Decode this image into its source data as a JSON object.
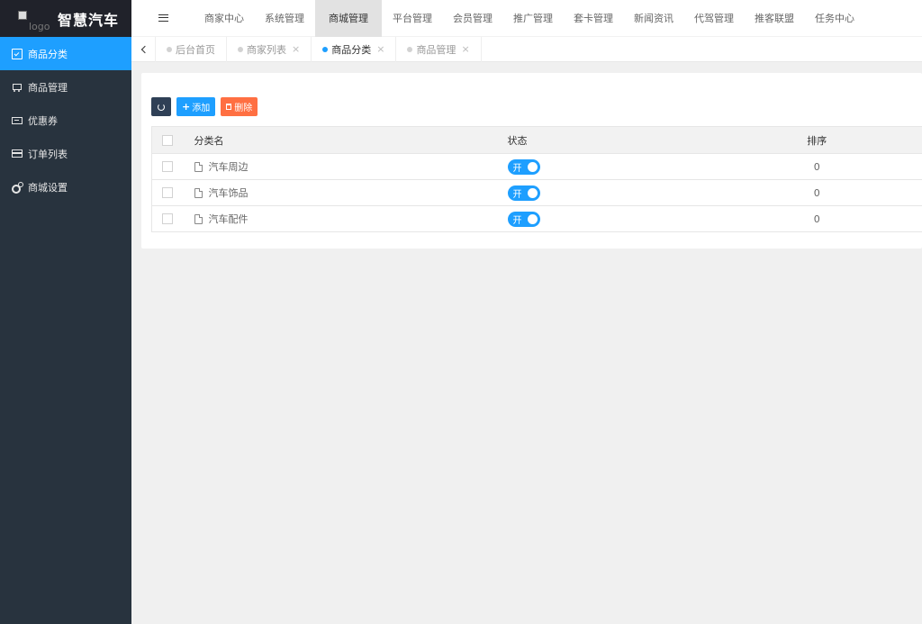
{
  "app": {
    "title": "智慧汽车",
    "logo_alt": "logo"
  },
  "sidebar": {
    "items": [
      {
        "label": "商品分类",
        "icon": "calendar-check-icon",
        "active": true
      },
      {
        "label": "商品管理",
        "icon": "cart-icon"
      },
      {
        "label": "优惠券",
        "icon": "money-icon"
      },
      {
        "label": "订单列表",
        "icon": "card-icon"
      },
      {
        "label": "商城设置",
        "icon": "gears-icon"
      }
    ]
  },
  "topnav": {
    "items": [
      {
        "label": "商家中心"
      },
      {
        "label": "系统管理"
      },
      {
        "label": "商城管理",
        "active": true
      },
      {
        "label": "平台管理"
      },
      {
        "label": "会员管理"
      },
      {
        "label": "推广管理"
      },
      {
        "label": "套卡管理"
      },
      {
        "label": "新闻资讯"
      },
      {
        "label": "代驾管理"
      },
      {
        "label": "推客联盟"
      },
      {
        "label": "任务中心"
      }
    ]
  },
  "tabs": [
    {
      "label": "后台首页",
      "closable": false
    },
    {
      "label": "商家列表",
      "closable": true,
      "close": "×"
    },
    {
      "label": "商品分类",
      "closable": true,
      "close": "×",
      "active": true
    },
    {
      "label": "商品管理",
      "closable": true,
      "close": "×"
    }
  ],
  "toolbar": {
    "add_label": "添加",
    "delete_label": "删除"
  },
  "table": {
    "columns": {
      "name": "分类名",
      "status": "状态",
      "sort": "排序"
    },
    "rows": [
      {
        "name": "汽车周边",
        "status": "开",
        "sort": "0"
      },
      {
        "name": "汽车饰品",
        "status": "开",
        "sort": "0"
      },
      {
        "name": "汽车配件",
        "status": "开",
        "sort": "0"
      }
    ]
  },
  "colors": {
    "accent": "#1e9fff",
    "sidebar_bg": "#28333e",
    "danger": "#ff5722",
    "dark_button": "#2f4056"
  }
}
